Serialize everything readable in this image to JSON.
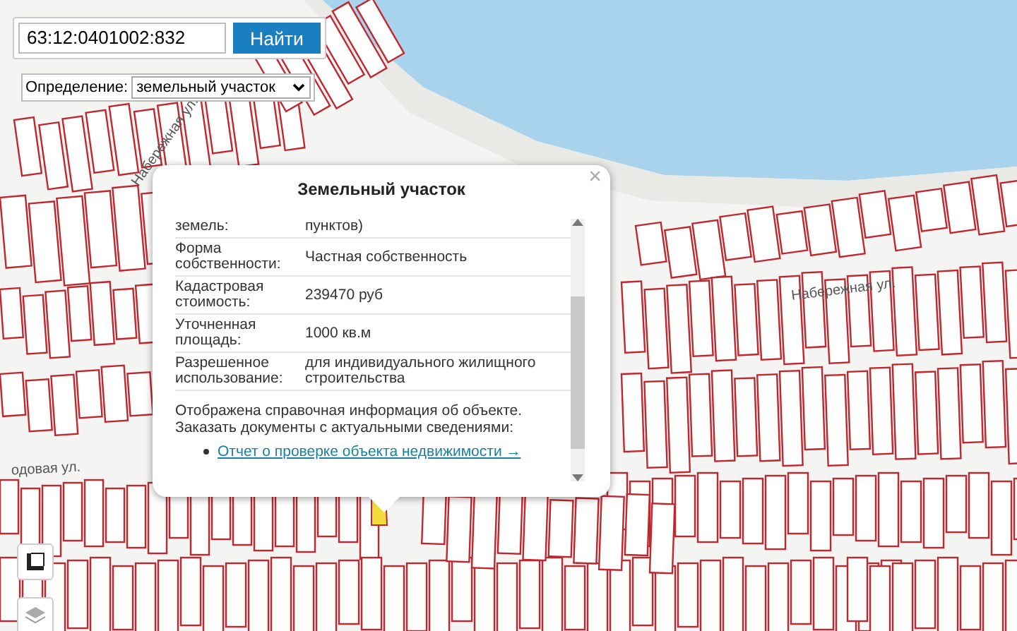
{
  "search": {
    "value": "63:12:0401002:832",
    "button": "Найти"
  },
  "definition": {
    "label": "Определение:",
    "value": "земельный участок"
  },
  "map": {
    "street_labels": [
      {
        "text": "Набережная ул.",
        "kind": "upper"
      },
      {
        "text": "Набережная ул.",
        "kind": "right"
      },
      {
        "text": "одовая ул.",
        "kind": "lower"
      }
    ]
  },
  "popup": {
    "title": "Земельный участок",
    "close": "×",
    "rows": [
      {
        "label": "земель:",
        "value": "пунктов)"
      },
      {
        "label": "Форма собственности:",
        "value": "Частная собственность"
      },
      {
        "label": "Кадастровая стоимость:",
        "value": "239470 руб"
      },
      {
        "label": "Уточненная площадь:",
        "value": "1000 кв.м"
      },
      {
        "label": "Разрешенное использование:",
        "value": "для индивидуального жилищного строительства"
      }
    ],
    "note": "Отображена справочная информация об объекте. Заказать документы с актуальными сведениями:",
    "link": "Отчет о проверке объекта недвижимости →"
  }
}
